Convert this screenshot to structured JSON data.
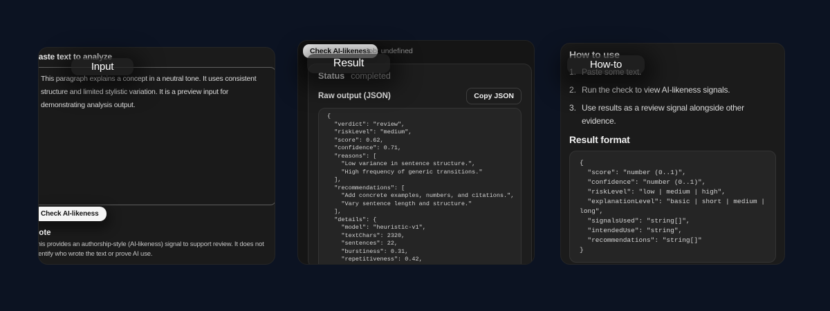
{
  "colors": {
    "background": "#0c1322",
    "card": "#1b1b1b",
    "code_background": "#252525",
    "primary_button": "#f5f5f5"
  },
  "annotations": {
    "input": "Input",
    "result": "Result",
    "howto": "How-to"
  },
  "input_panel": {
    "label": "Paste text to analyze",
    "textarea_value": "This paragraph explains a concept in a neutral tone. It uses consistent\nstructure and limited stylistic variation. It is a preview input for\ndemonstrating analysis output.",
    "check_button": "Check AI-likeness",
    "note_title": "Note",
    "note_body": "This provides an authorship-style (AI-likeness) signal to support review. It does not\nidentify who wrote the text or prove AI use."
  },
  "result_panel": {
    "check_button": "Check AI-likeness",
    "job_status": "Job: undefined",
    "status_label": "Status",
    "status_value": "completed",
    "raw_output_label": "Raw output (JSON)",
    "copy_button": "Copy JSON",
    "raw_json": "{\n  \"verdict\": \"review\",\n  \"riskLevel\": \"medium\",\n  \"score\": 0.62,\n  \"confidence\": 0.71,\n  \"reasons\": [\n    \"Low variance in sentence structure.\",\n    \"High frequency of generic transitions.\"\n  ],\n  \"recommendations\": [\n    \"Add concrete examples, numbers, and citations.\",\n    \"Vary sentence length and structure.\"\n  ],\n  \"details\": {\n    \"model\": \"heuristic-v1\",\n    \"textChars\": 2320,\n    \"sentences\": 22,\n    \"burstiness\": 0.31,\n    \"repetitiveness\": 0.42,\n    \"topSignals\": [\n      \"low-burstiness\","
  },
  "help_panel": {
    "howto_title": "How to use",
    "steps": [
      {
        "num": "1.",
        "text": "Paste some text."
      },
      {
        "num": "2.",
        "text": "Run the check to view AI-likeness signals."
      },
      {
        "num": "3.",
        "text": "Use results as a review signal alongside other\nevidence."
      }
    ],
    "format_title": "Result format",
    "format_json": "{\n  \"score\": \"number (0..1)\",\n  \"confidence\": \"number (0..1)\",\n  \"riskLevel\": \"low | medium | high\",\n  \"explanationLevel\": \"basic | short | medium | long\",\n  \"signalsUsed\": \"string[]\",\n  \"intendedUse\": \"string\",\n  \"recommendations\": \"string[]\"\n}"
  }
}
